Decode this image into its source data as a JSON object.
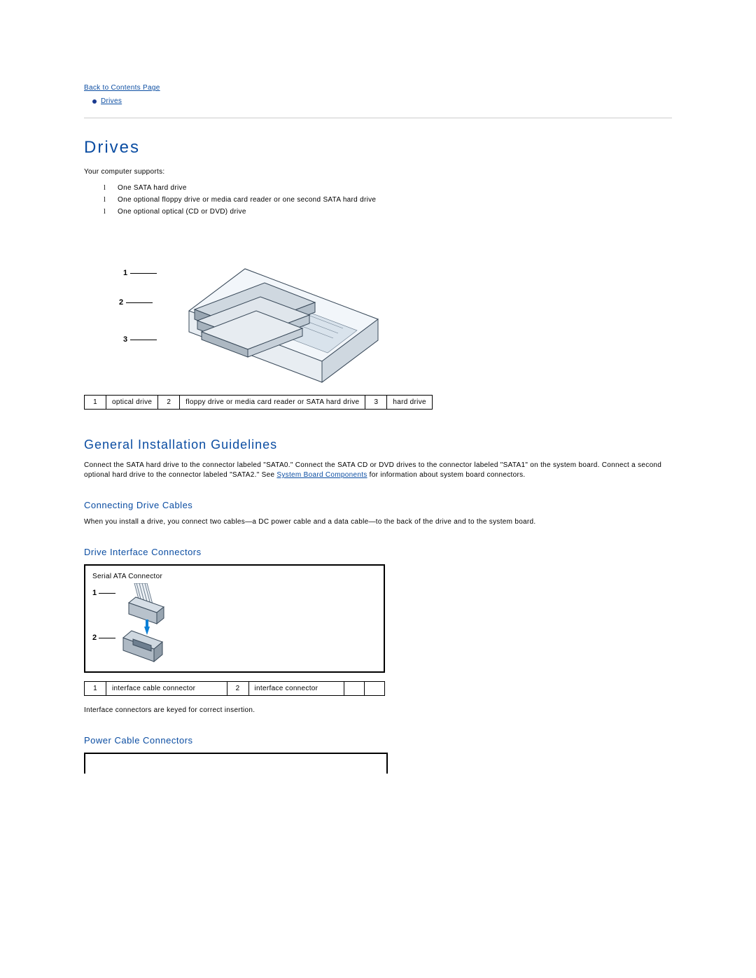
{
  "nav": {
    "back_link": "Back to Contents Page",
    "topic_link": "Drives"
  },
  "drives": {
    "heading": "Drives",
    "intro": "Your computer supports:",
    "items": [
      "One SATA hard drive",
      "One optional floppy drive or media card reader or one second SATA hard drive",
      "One optional optical (CD or DVD) drive"
    ],
    "callouts": {
      "c1": "1",
      "c2": "2",
      "c3": "3"
    },
    "legend": {
      "n1": "1",
      "t1": "optical drive",
      "n2": "2",
      "t2": "floppy drive or media card reader or SATA hard drive",
      "n3": "3",
      "t3": "hard drive"
    }
  },
  "guidelines": {
    "heading": "General Installation Guidelines",
    "para_a": "Connect the SATA hard drive to the connector labeled \"SATA0.\" Connect the SATA CD or DVD drives to the connector labeled \"SATA1\" on the system board. Connect a second optional hard drive to the connector labeled \"SATA2.\" See ",
    "link_text": "System Board Components",
    "para_b": " for information about system board connectors."
  },
  "cables": {
    "heading": "Connecting Drive Cables",
    "para": "When you install a drive, you connect two cables—a DC power cable and a data cable—to the back of the drive and to the system board."
  },
  "interface": {
    "heading": "Drive Interface Connectors",
    "box_title": "Serial ATA Connector",
    "callouts": {
      "c1": "1",
      "c2": "2"
    },
    "legend": {
      "n1": "1",
      "t1": "interface cable connector",
      "n2": "2",
      "t2": "interface connector"
    },
    "note": "Interface connectors are keyed for correct insertion."
  },
  "power": {
    "heading": "Power Cable Connectors"
  }
}
